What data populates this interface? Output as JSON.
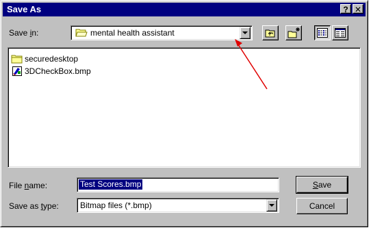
{
  "window": {
    "title": "Save As",
    "help_glyph": "?",
    "close_glyph": "✕"
  },
  "save_in": {
    "label_pre": "Save ",
    "label_accel": "i",
    "label_post": "n:",
    "value": "mental health assistant"
  },
  "toolbar": {
    "icons": [
      "up-one-level-icon",
      "create-new-folder-icon",
      "list-view-icon",
      "details-view-icon"
    ]
  },
  "files": [
    {
      "name": "securedesktop",
      "icon": "folder-icon"
    },
    {
      "name": "3DCheckBox.bmp",
      "icon": "bitmap-file-icon"
    }
  ],
  "file_name": {
    "label_pre": "File ",
    "label_accel": "n",
    "label_post": "ame:",
    "value": "Test Scores.bmp"
  },
  "save_as_type": {
    "label_pre": "Save as ",
    "label_accel": "t",
    "label_post": "ype:",
    "value": "Bitmap files (*.bmp)"
  },
  "buttons": {
    "save_accel": "S",
    "save_rest": "ave",
    "cancel": "Cancel"
  },
  "annotation": {
    "arrow_color": "#e00000"
  }
}
